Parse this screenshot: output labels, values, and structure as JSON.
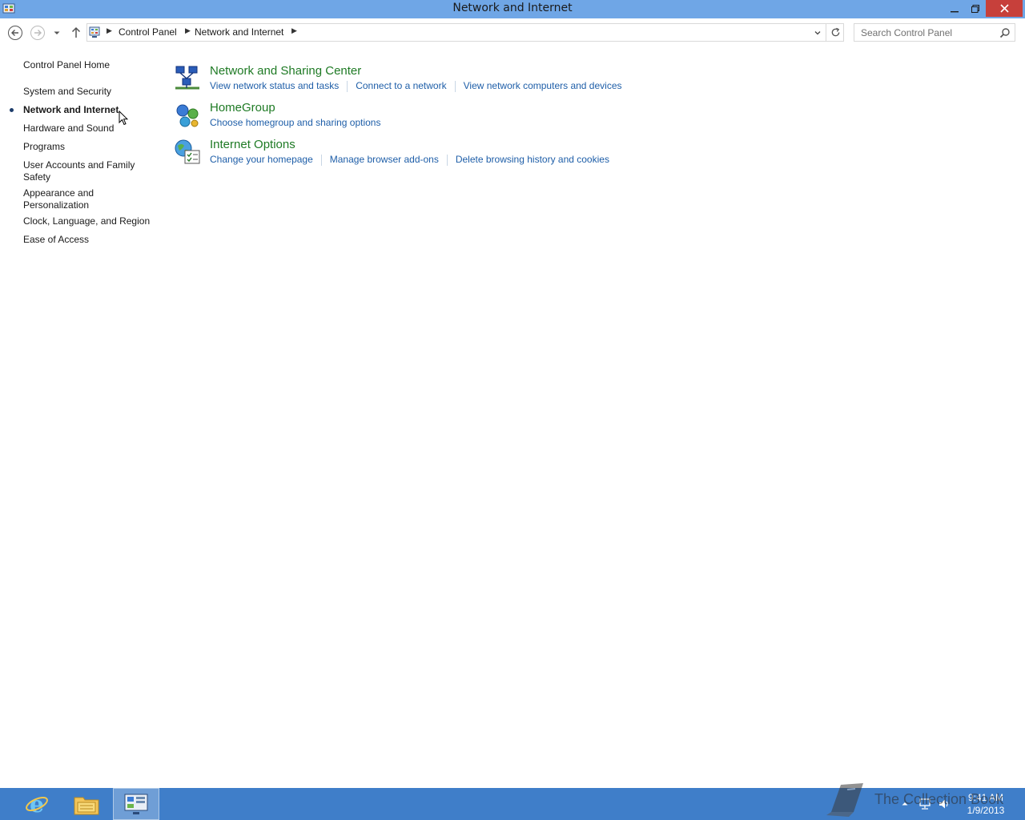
{
  "window": {
    "title": "Network and Internet",
    "minimize_glyph": "🗕",
    "maximize_glyph": "🗗",
    "close_glyph": "✕"
  },
  "address_bar": {
    "breadcrumbs": [
      "Control Panel",
      "Network and Internet"
    ],
    "search_placeholder": "Search Control Panel"
  },
  "sidebar": {
    "home": "Control Panel Home",
    "items": [
      {
        "label": "System and Security",
        "active": false
      },
      {
        "label": "Network and Internet",
        "active": true
      },
      {
        "label": "Hardware and Sound",
        "active": false
      },
      {
        "label": "Programs",
        "active": false
      },
      {
        "label": "User Accounts and Family Safety",
        "active": false
      },
      {
        "label": "Appearance and Personalization",
        "active": false
      },
      {
        "label": "Clock, Language, and Region",
        "active": false
      },
      {
        "label": "Ease of Access",
        "active": false
      }
    ]
  },
  "categories": [
    {
      "title": "Network and Sharing Center",
      "icon": "network-sharing-icon",
      "links": [
        "View network status and tasks",
        "Connect to a network",
        "View network computers and devices"
      ]
    },
    {
      "title": "HomeGroup",
      "icon": "homegroup-icon",
      "links": [
        "Choose homegroup and sharing options"
      ]
    },
    {
      "title": "Internet Options",
      "icon": "internet-options-icon",
      "links": [
        "Change your homepage",
        "Manage browser add-ons",
        "Delete browsing history and cookies"
      ]
    }
  ],
  "taskbar": {
    "apps": [
      "internet-explorer-icon",
      "file-explorer-icon",
      "control-panel-icon"
    ],
    "clock_time": "9:41 AM",
    "clock_date": "1/9/2013",
    "watermark": "The Collection Book"
  },
  "colors": {
    "titlebar": "#6fa6e6",
    "category_title": "#1e7a24",
    "link": "#1e5ea8",
    "taskbar": "#3f7ec9",
    "close_button": "#c7403b"
  }
}
